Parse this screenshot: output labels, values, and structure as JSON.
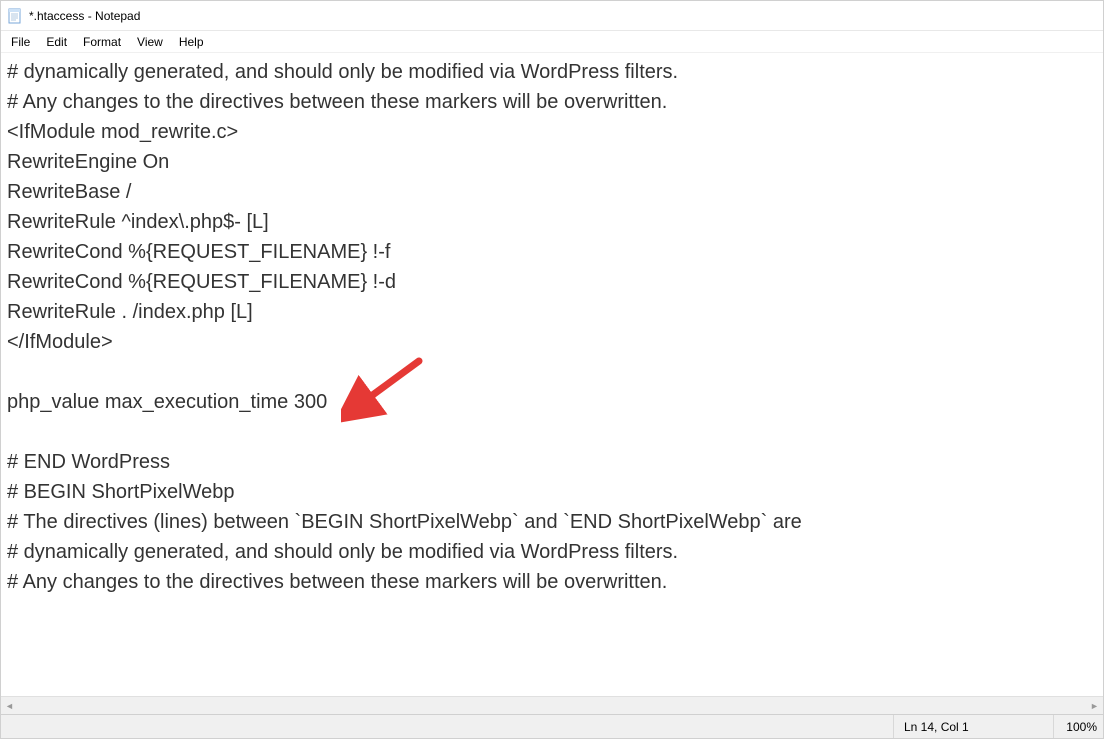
{
  "window": {
    "title": "*.htaccess - Notepad"
  },
  "menubar": {
    "items": [
      "File",
      "Edit",
      "Format",
      "View",
      "Help"
    ]
  },
  "editor": {
    "content": "# dynamically generated, and should only be modified via WordPress filters.\n# Any changes to the directives between these markers will be overwritten.\n<IfModule mod_rewrite.c>\nRewriteEngine On\nRewriteBase /\nRewriteRule ^index\\.php$- [L]\nRewriteCond %{REQUEST_FILENAME} !-f\nRewriteCond %{REQUEST_FILENAME} !-d\nRewriteRule . /index.php [L]\n</IfModule>\n\nphp_value max_execution_time 300\n\n# END WordPress\n# BEGIN ShortPixelWebp\n# The directives (lines) between `BEGIN ShortPixelWebp` and `END ShortPixelWebp` are\n# dynamically generated, and should only be modified via WordPress filters.\n# Any changes to the directives between these markers will be overwritten."
  },
  "statusbar": {
    "position": "Ln 14, Col 1",
    "zoom": "100%"
  },
  "annotation": {
    "arrow_color": "#e53935"
  }
}
